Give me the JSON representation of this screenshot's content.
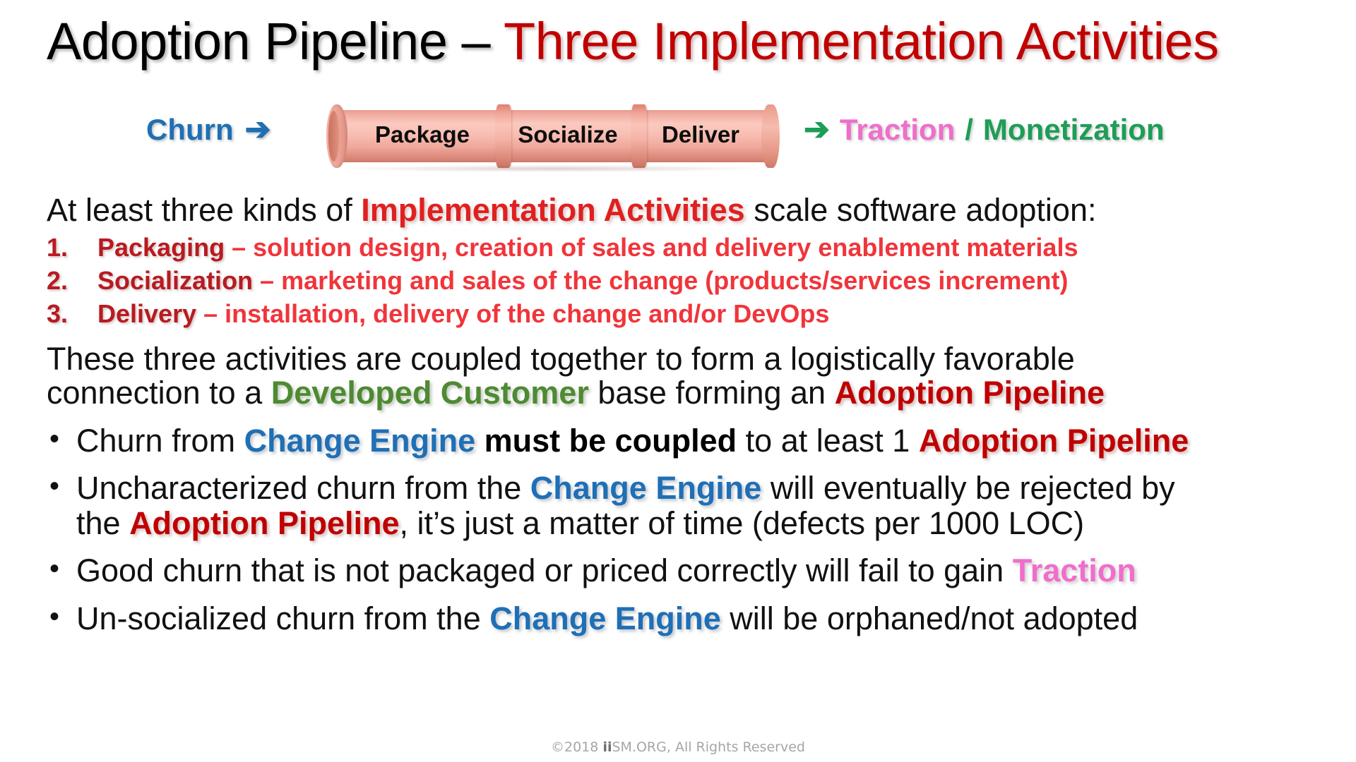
{
  "title": {
    "black_part": "Adoption Pipeline – ",
    "red_part": "Three Implementation Activities"
  },
  "pipeline_diagram": {
    "left_label": "Churn",
    "left_arrow": "right-arrow-icon",
    "left_arrow_glyph": "➔",
    "segments": [
      "Package",
      "Socialize",
      "Deliver"
    ],
    "right_arrow": "right-arrow-icon",
    "right_arrow_glyph": "➔",
    "right_label_primary": "Traction",
    "right_label_separator": " / ",
    "right_label_secondary": "Monetization",
    "colors": {
      "churn_blue": "#1F6FB5",
      "traction_pink": "#F06ECB",
      "monetization_green": "#1E9D57",
      "pipe_salmon": "#F3B1A4"
    }
  },
  "body": {
    "intro": {
      "part1": "At least three kinds of ",
      "emphasis": "Implementation Activities",
      "part2": " scale software adoption:"
    },
    "numbered_items": [
      {
        "marker": "1.",
        "term": "Packaging",
        "dash": " – ",
        "description": "solution design, creation of sales and delivery enablement materials"
      },
      {
        "marker": "2.",
        "term": "Socialization",
        "dash": " – ",
        "description": "marketing and sales of the change (products/services increment)"
      },
      {
        "marker": "3.",
        "term": "Delivery",
        "dash": " – ",
        "description": "installation, delivery of the change and/or DevOps"
      }
    ],
    "paragraph": {
      "line1": "These three activities are coupled together to form a logistically favorable",
      "line2_part1": "connection to a ",
      "line2_green": "Developed Customer",
      "line2_part2": " base forming an ",
      "line2_red": "Adoption Pipeline"
    },
    "bullets": [
      {
        "segments_line1": {
          "a": "Churn from ",
          "blue": "Change Engine",
          "b": " ",
          "bold": "must be coupled",
          "c": " to at least 1 ",
          "red": "Adoption Pipeline"
        }
      },
      {
        "segments_line1": {
          "a": "Uncharacterized churn from the ",
          "blue": "Change Engine",
          "b": " will eventually be rejected by"
        },
        "segments_line2": {
          "a": "the ",
          "red": "Adoption Pipeline",
          "b": ", it’s just a matter of time (defects per 1000 LOC)"
        }
      },
      {
        "segments_line1": {
          "a": "Good churn that is not packaged or priced correctly will fail to gain ",
          "pink": "Traction"
        }
      },
      {
        "segments_line1": {
          "a": "Un-socialized churn from the ",
          "blue": "Change Engine",
          "b": " will be orphaned/not adopted"
        }
      }
    ]
  },
  "footer": {
    "copyright": "©2018 ",
    "brand_bold": "ii",
    "brand_rest": "SM.ORG,",
    "rights": " All Rights Reserved"
  }
}
